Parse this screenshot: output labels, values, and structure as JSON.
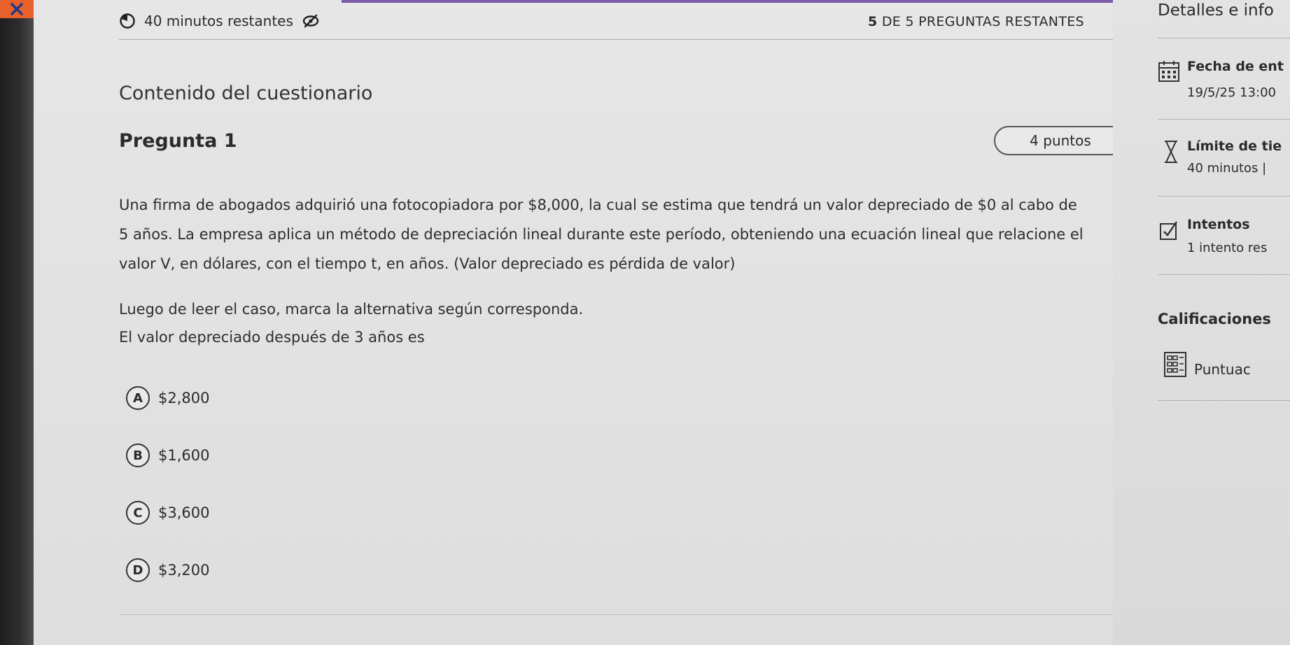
{
  "header": {
    "timer_text": "40 minutos restantes",
    "questions_remaining_count": "5",
    "questions_remaining_text": "DE 5 PREGUNTAS RESTANTES"
  },
  "main": {
    "section_title": "Contenido del cuestionario",
    "question": {
      "title": "Pregunta 1",
      "points": "4 puntos",
      "body_lines": [
        "Una firma de abogados adquirió una fotocopiadora por $8,000, la cual se estima que tendrá un valor depreciado de $0 al cabo de",
        "5 años. La empresa aplica un método de depreciación lineal durante este período, obteniendo una ecuación lineal que relacione el",
        "valor V, en dólares, con el tiempo t, en años. (Valor depreciado es pérdida de valor)"
      ],
      "instruction": "Luego de leer el caso, marca la alternativa según corresponda.",
      "prompt": "El valor depreciado después de 3 años es",
      "options": [
        {
          "letter": "A",
          "text": "$2,800"
        },
        {
          "letter": "B",
          "text": "$1,600"
        },
        {
          "letter": "C",
          "text": "$3,600"
        },
        {
          "letter": "D",
          "text": "$3,200"
        }
      ]
    }
  },
  "sidebar": {
    "title": "Detalles e info",
    "due_date_label": "Fecha de ent",
    "due_date_value": "19/5/25 13:00",
    "time_limit_label": "Límite de tie",
    "time_limit_value": "40 minutos |",
    "attempts_label": "Intentos",
    "attempts_value": "1 intento res",
    "grades_title": "Calificaciones",
    "score_label": "Puntuac"
  },
  "colors": {
    "accent_bar": "#7a5da8",
    "close_button": "#e8602a"
  },
  "icons": [
    "close-icon",
    "timer-icon",
    "visibility-off-icon",
    "calendar-icon",
    "hourglass-icon",
    "checkbox-icon",
    "gradebook-icon"
  ]
}
